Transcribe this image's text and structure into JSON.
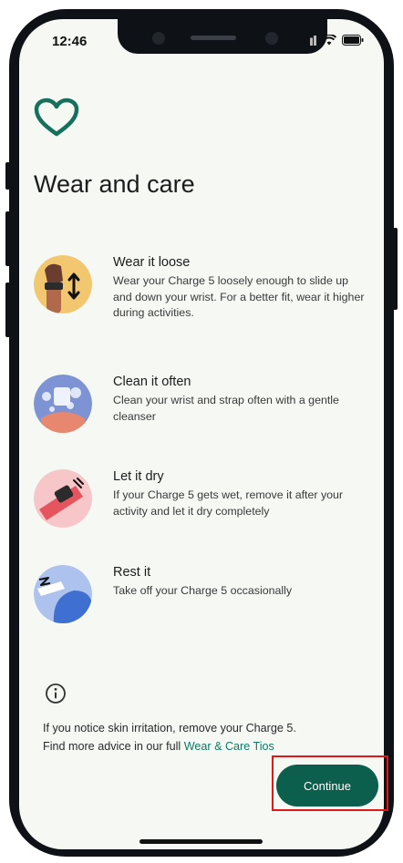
{
  "status_bar": {
    "time": "12:46"
  },
  "page": {
    "title": "Wear and care"
  },
  "items": [
    {
      "title": "Wear it loose",
      "description": "Wear your Charge 5 loosely enough to slide up and down your wrist. For a better fit, wear it higher during activities."
    },
    {
      "title": "Clean it often",
      "description": "Clean your wrist and strap often with a gentle cleanser"
    },
    {
      "title": "Let it dry",
      "description": "If your Charge 5 gets wet, remove it after your activity and let it dry completely"
    },
    {
      "title": "Rest it",
      "description": "Take off your Charge 5 occasionally"
    }
  ],
  "note": {
    "line1": "If you notice skin irritation, remove your Charge 5.",
    "line2_prefix": "Find more advice in our full ",
    "link": "Wear & Care Tios"
  },
  "actions": {
    "continue_label": "Continue"
  },
  "colors": {
    "accent": "#0c5e4d",
    "link": "#0f7a63",
    "highlight": "#e01818",
    "background": "#f6f8f4"
  }
}
